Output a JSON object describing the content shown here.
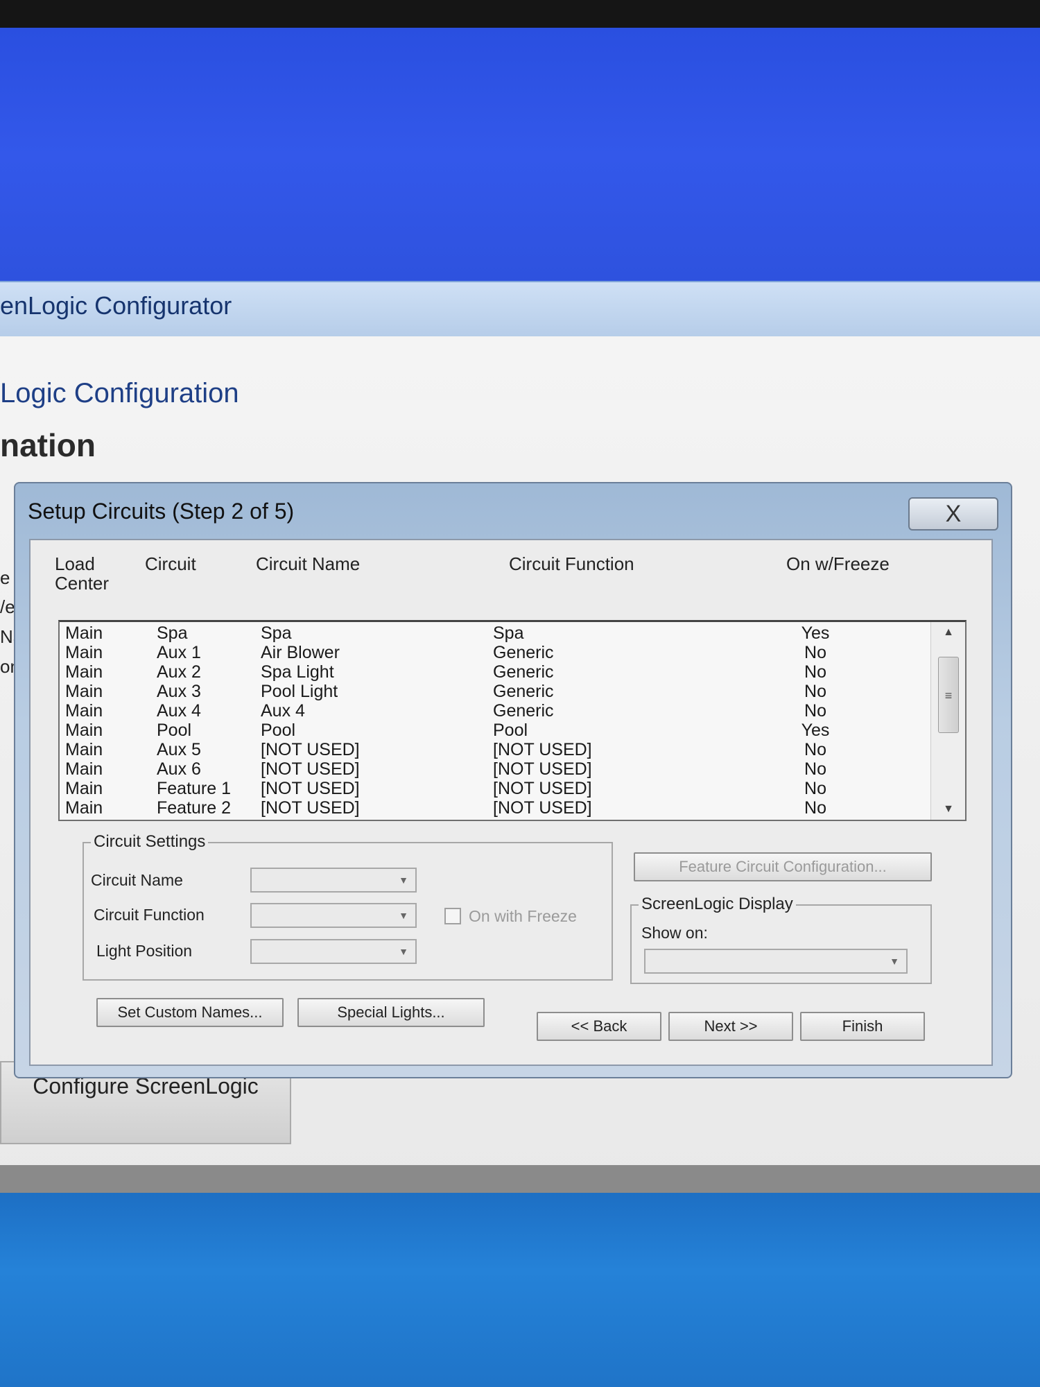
{
  "app": {
    "title": "enLogic Configurator",
    "heading1": "Logic Configuration",
    "heading2": "nation",
    "side_labels": [
      "e",
      "/er",
      "Nar",
      "on"
    ],
    "configure_button": "Configure ScreenLogic"
  },
  "dialog": {
    "title": "Setup Circuits (Step 2 of 5)",
    "close_symbol": "X",
    "columns": {
      "load_center": "Load Center",
      "circuit": "Circuit",
      "circuit_name": "Circuit Name",
      "circuit_function": "Circuit Function",
      "on_freeze": "On w/Freeze"
    },
    "rows": [
      {
        "load_center": "Main",
        "circuit": "Spa",
        "name": "Spa",
        "function": "Spa",
        "freeze": "Yes"
      },
      {
        "load_center": "Main",
        "circuit": "Aux 1",
        "name": "Air Blower",
        "function": "Generic",
        "freeze": "No"
      },
      {
        "load_center": "Main",
        "circuit": "Aux 2",
        "name": "Spa Light",
        "function": "Generic",
        "freeze": "No"
      },
      {
        "load_center": "Main",
        "circuit": "Aux 3",
        "name": "Pool Light",
        "function": "Generic",
        "freeze": "No"
      },
      {
        "load_center": "Main",
        "circuit": "Aux 4",
        "name": "Aux 4",
        "function": "Generic",
        "freeze": "No"
      },
      {
        "load_center": "Main",
        "circuit": "Pool",
        "name": "Pool",
        "function": "Pool",
        "freeze": "Yes"
      },
      {
        "load_center": "Main",
        "circuit": "Aux 5",
        "name": "[NOT USED]",
        "function": "[NOT USED]",
        "freeze": "No"
      },
      {
        "load_center": "Main",
        "circuit": "Aux 6",
        "name": "[NOT USED]",
        "function": "[NOT USED]",
        "freeze": "No"
      },
      {
        "load_center": "Main",
        "circuit": "Feature 1",
        "name": "[NOT USED]",
        "function": "[NOT USED]",
        "freeze": "No"
      },
      {
        "load_center": "Main",
        "circuit": "Feature 2",
        "name": "[NOT USED]",
        "function": "[NOT USED]",
        "freeze": "No"
      }
    ],
    "scroll_thumb_glyph": "≡",
    "circuit_settings": {
      "label": "Circuit Settings",
      "circuit_name_label": "Circuit Name",
      "circuit_function_label": "Circuit Function",
      "light_position_label": "Light Position",
      "on_with_freeze_label": "On with Freeze"
    },
    "feature_circuit_button": "Feature Circuit Configuration...",
    "screenlogic_display": {
      "label": "ScreenLogic Display",
      "show_on_label": "Show on:"
    },
    "buttons": {
      "set_custom_names": "Set Custom Names...",
      "special_lights": "Special Lights...",
      "back": "<< Back",
      "next": "Next >>",
      "finish": "Finish"
    }
  }
}
